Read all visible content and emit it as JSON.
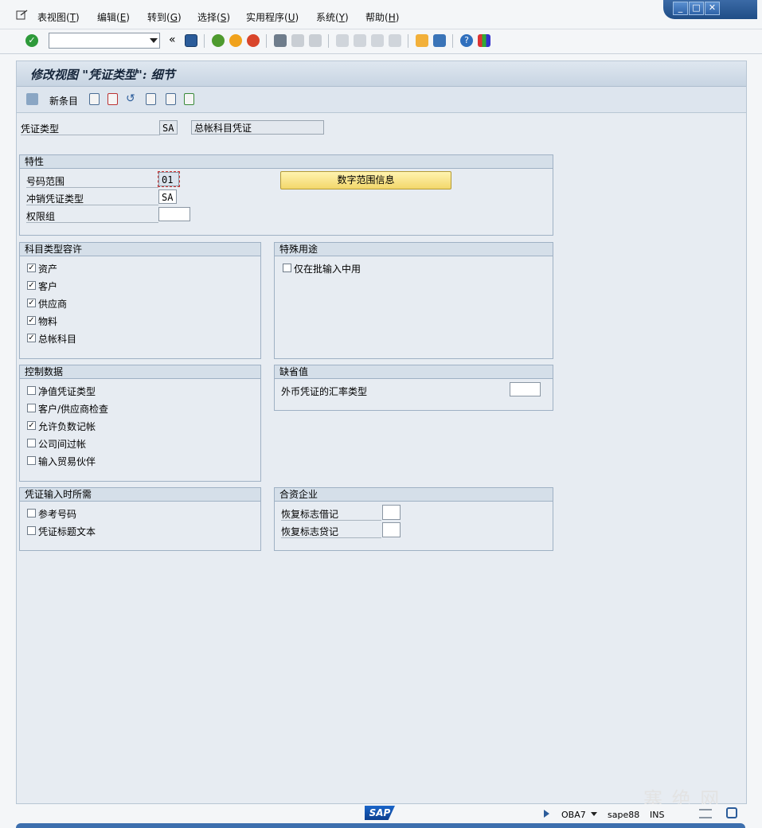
{
  "menu": [
    {
      "label": "表视图(",
      "acc": "T",
      "tail": ")"
    },
    {
      "label": "编辑(",
      "acc": "E",
      "tail": ")"
    },
    {
      "label": "转到(",
      "acc": "G",
      "tail": ")"
    },
    {
      "label": "选择(",
      "acc": "S",
      "tail": ")"
    },
    {
      "label": "实用程序(",
      "acc": "U",
      "tail": ")"
    },
    {
      "label": "系统(",
      "acc": "Y",
      "tail": ")"
    },
    {
      "label": "帮助(",
      "acc": "H",
      "tail": ")"
    }
  ],
  "toolbar": {
    "command_value": "",
    "chevron": "«"
  },
  "title": "修改视图 \"凭证类型\": 细节",
  "app_toolbar": {
    "new_entries_label": "新条目"
  },
  "header": {
    "doc_type_label": "凭证类型",
    "doc_type_value": "SA",
    "doc_type_desc": "总帐科目凭证"
  },
  "properties": {
    "title": "特性",
    "number_range_label": "号码范围",
    "number_range_value": "01",
    "reverse_type_label": "冲销凭证类型",
    "reverse_type_value": "SA",
    "auth_group_label": "权限组",
    "auth_group_value": "",
    "num_range_btn": "数字范围信息"
  },
  "account_types": {
    "title": "科目类型容许",
    "items": [
      {
        "label": "资产",
        "checked": true
      },
      {
        "label": "客户",
        "checked": true
      },
      {
        "label": "供应商",
        "checked": true
      },
      {
        "label": "物料",
        "checked": true
      },
      {
        "label": "总帐科目",
        "checked": true
      }
    ]
  },
  "special_usage": {
    "title": "特殊用途",
    "items": [
      {
        "label": "仅在批输入中用",
        "checked": false
      }
    ]
  },
  "control_data": {
    "title": "控制数据",
    "items": [
      {
        "label": "净值凭证类型",
        "checked": false
      },
      {
        "label": "客户/供应商检查",
        "checked": false
      },
      {
        "label": "允许负数记帐",
        "checked": true
      },
      {
        "label": "公司间过帐",
        "checked": false
      },
      {
        "label": "输入贸易伙伴",
        "checked": false
      }
    ]
  },
  "defaults": {
    "title": "缺省值",
    "fx_rate_label": "外币凭证的汇率类型",
    "fx_rate_value": ""
  },
  "required_entry": {
    "title": "凭证输入时所需",
    "items": [
      {
        "label": "参考号码",
        "checked": false
      },
      {
        "label": "凭证标题文本",
        "checked": false
      }
    ]
  },
  "joint_venture": {
    "title": "合资企业",
    "debit_label": "恢复标志借记",
    "debit_value": "",
    "credit_label": "恢复标志贷记",
    "credit_value": ""
  },
  "status": {
    "logo": "SAP",
    "transaction": "OBA7",
    "server": "sape88",
    "mode": "INS"
  },
  "watermark": "塞 绝 网",
  "colors": {
    "accent": "#1f4d86",
    "button_yellow": "#f3d76b"
  }
}
